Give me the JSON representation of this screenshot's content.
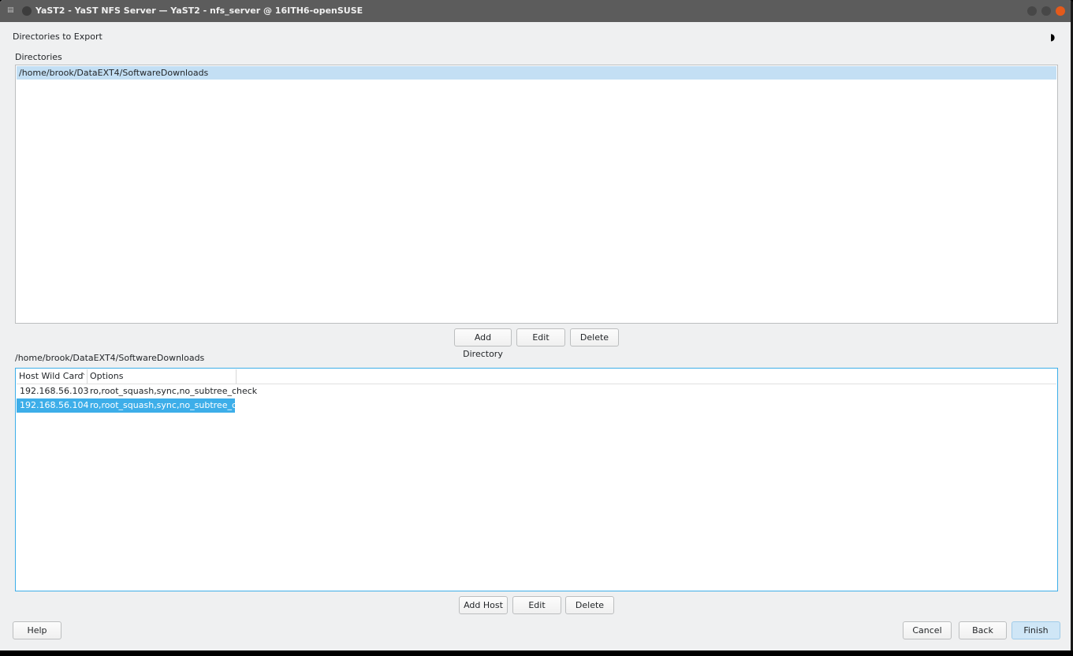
{
  "window": {
    "title": "YaST2 - YaST NFS Server — YaST2 - nfs_server @ 16ITH6-openSUSE",
    "menu_icon": "app-menu-icon",
    "controls": [
      "minimize",
      "maximize",
      "close"
    ],
    "close_color": "#e45a1b"
  },
  "page": {
    "heading": "Directories to Export",
    "theme_icon": "◗"
  },
  "directories": {
    "label": "Directories",
    "items": [
      "/home/brook/DataEXT4/SoftwareDownloads"
    ],
    "selected_index": 0,
    "buttons": {
      "add": "Add Directory",
      "edit": "Edit",
      "delete": "Delete"
    }
  },
  "hosts": {
    "label": "/home/brook/DataEXT4/SoftwareDownloads",
    "columns": [
      "Host Wild Card",
      "Options"
    ],
    "sort_indicator": "^",
    "rows": [
      {
        "host": "192.168.56.103",
        "options": "ro,root_squash,sync,no_subtree_check"
      },
      {
        "host": "192.168.56.104",
        "options": "ro,root_squash,sync,no_subtree_check"
      }
    ],
    "selected_index": 1,
    "buttons": {
      "add": "Add Host",
      "edit": "Edit",
      "delete": "Delete"
    }
  },
  "footer": {
    "help": "Help",
    "cancel": "Cancel",
    "back": "Back",
    "finish": "Finish"
  },
  "colors": {
    "selection": "#3daee9",
    "dir_selection": "#c3dff4",
    "accent": "#3daee9"
  }
}
